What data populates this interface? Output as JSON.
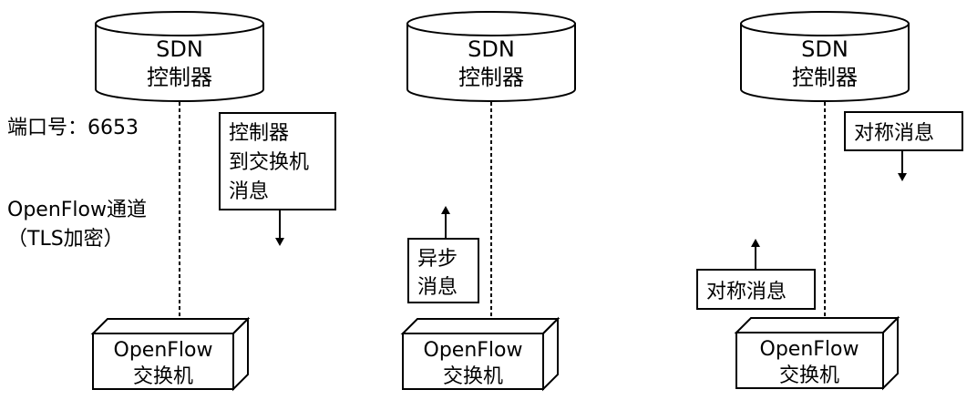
{
  "panels": [
    {
      "controller": {
        "line1": "SDN",
        "line2": "控制器"
      },
      "switch": {
        "line1": "OpenFlow",
        "line2": "交换机"
      },
      "message": {
        "lines": [
          "控制器",
          "到交换机",
          "消息"
        ],
        "direction": "down"
      }
    },
    {
      "controller": {
        "line1": "SDN",
        "line2": "控制器"
      },
      "switch": {
        "line1": "OpenFlow",
        "line2": "交换机"
      },
      "message": {
        "lines": [
          "异步",
          "消息"
        ],
        "direction": "up"
      }
    },
    {
      "controller": {
        "line1": "SDN",
        "line2": "控制器"
      },
      "switch": {
        "line1": "OpenFlow",
        "line2": "交换机"
      },
      "message_down": {
        "lines": [
          "对称消息"
        ],
        "direction": "down"
      },
      "message_up": {
        "lines": [
          "对称消息"
        ],
        "direction": "up"
      }
    }
  ],
  "annotations": {
    "port": "端口号：6653",
    "channel": "OpenFlow通道",
    "tls": "（TLS加密）"
  }
}
